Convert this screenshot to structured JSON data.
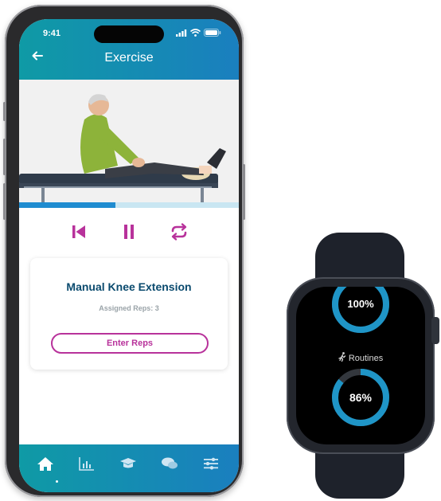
{
  "phone": {
    "status": {
      "time": "9:41"
    },
    "header": {
      "title": "Exercise"
    },
    "video": {
      "progress": 0.44
    },
    "exercise": {
      "title": "Manual Knee Extension",
      "assigned": "Assigned Reps: 3",
      "enter_button": "Enter Reps"
    },
    "tabs": [
      "home-icon",
      "chart-icon",
      "education-icon",
      "chat-icon",
      "settings-icon"
    ]
  },
  "watch": {
    "ring1_value": "100%",
    "ring1_fraction": 1.0,
    "routines_label": "Routines",
    "ring2_value": "86%",
    "ring2_fraction": 0.86
  },
  "colors": {
    "accent": "#1a8fc5",
    "brand_teal": "#0f9aa5",
    "magenta": "#b8329b",
    "title_navy": "#0a4a6e"
  }
}
